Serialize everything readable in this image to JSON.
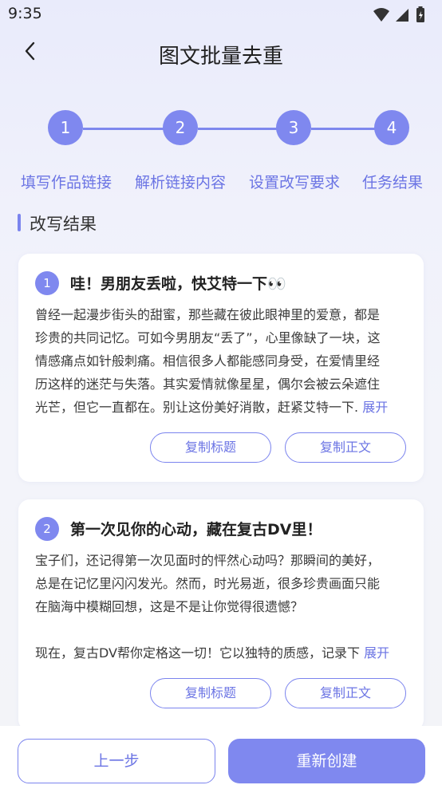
{
  "status_bar": {
    "time": "9:35"
  },
  "header": {
    "title": "图文批量去重"
  },
  "steps": [
    {
      "number": "1",
      "label": "填写作品链接"
    },
    {
      "number": "2",
      "label": "解析链接内容"
    },
    {
      "number": "3",
      "label": "设置改写要求"
    },
    {
      "number": "4",
      "label": "任务结果"
    }
  ],
  "section": {
    "title": "改写结果"
  },
  "results": [
    {
      "index": "1",
      "title": "哇！男朋友丢啦，快艾特一下👀",
      "body_lines": [
        "曾经一起漫步街头的甜蜜，那些藏在彼此眼神里的爱意，都是",
        "珍贵的共同记忆。可如今男朋友“丢了”，心里像缺了一块，这",
        "情感痛点如针般刺痛。相信很多人都能感同身受，在爱情里经",
        "历这样的迷茫与失落。其实爱情就像星星，偶尔会被云朵遮住",
        "光芒，但它一直都在。别让这份美好消散，赶紧艾特一下"
      ],
      "expand_label": "展开",
      "copy_title_label": "复制标题",
      "copy_body_label": "复制正文"
    },
    {
      "index": "2",
      "title": "第一次见你的心动，藏在复古DV里！",
      "body_lines": [
        "宝子们，还记得第一次见面时的怦然心动吗？那瞬间的美好，",
        "总是在记忆里闪闪发光。然而，时光易逝，很多珍贵画面只能",
        "在脑海中模糊回想，这是不是让你觉得很遗憾？",
        "",
        "现在，复古DV帮你定格这一切！它以独特的质感，记录下"
      ],
      "expand_label": "展开",
      "copy_title_label": "复制标题",
      "copy_body_label": "复制正文"
    }
  ],
  "bottom": {
    "prev_label": "上一步",
    "recreate_label": "重新创建"
  },
  "colors": {
    "accent": "#7f88ef",
    "accent_text": "#6b74e4"
  }
}
